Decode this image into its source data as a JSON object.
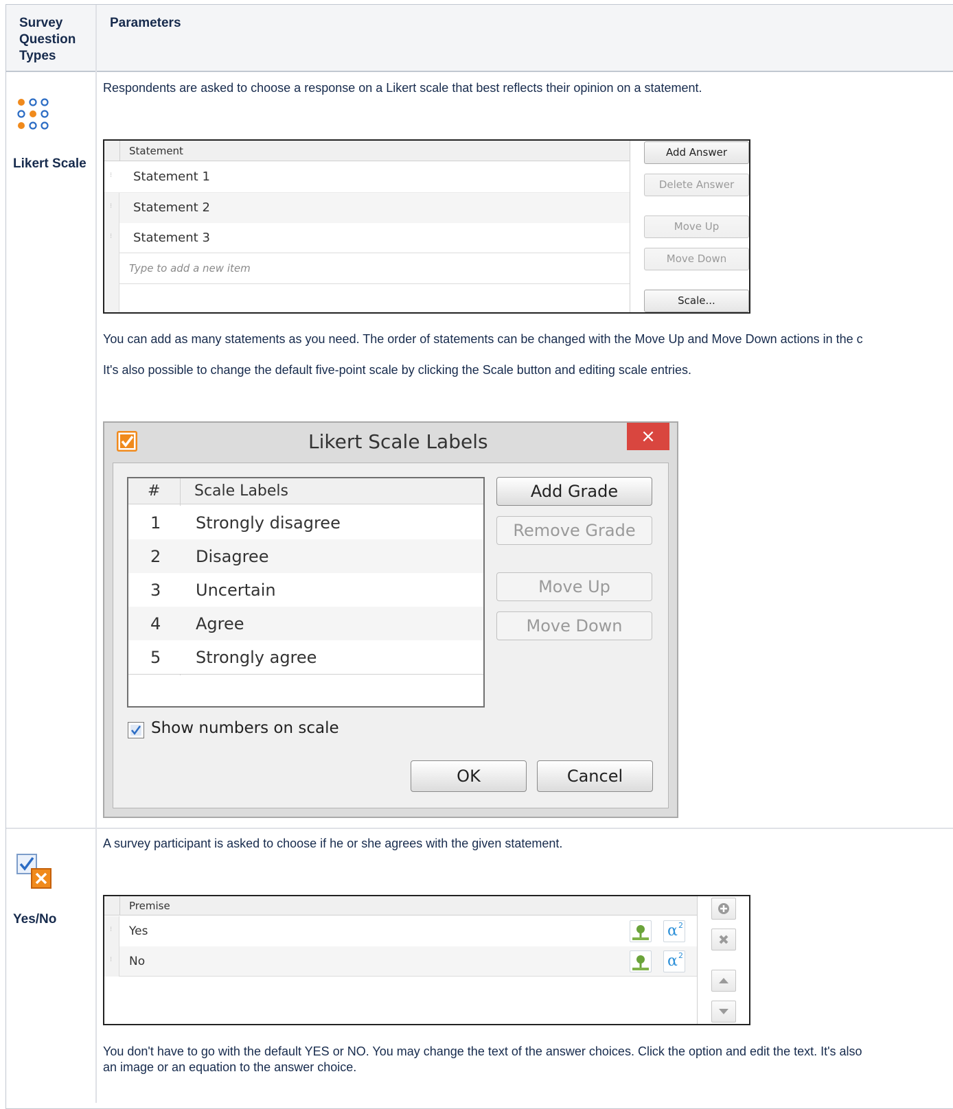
{
  "table": {
    "header_col1": "Survey Question Types",
    "header_col2": "Parameters"
  },
  "likert": {
    "label": "Likert Scale",
    "intro": "Respondents are asked to choose a response on a Likert scale that best reflects  their opinion on a statement.",
    "grid": {
      "header": "Statement",
      "rows": [
        "Statement 1",
        "Statement 2",
        "Statement 3"
      ],
      "placeholder": "Type to add a new item"
    },
    "buttons": {
      "add": "Add Answer",
      "delete": "Delete Answer",
      "move_up": "Move Up",
      "move_down": "Move Down",
      "scale": "Scale..."
    },
    "para1": "You can add as many statements as you need. The order of statements can be changed with the Move Up and Move Down actions in the c",
    "para2": "It's also possible to change the default five-point scale by clicking the Scale button and editing scale entries."
  },
  "dialog": {
    "title": "Likert Scale Labels",
    "close": "×",
    "grid": {
      "col_num": "#",
      "col_label": "Scale Labels",
      "rows": [
        {
          "num": "1",
          "label": "Strongly disagree"
        },
        {
          "num": "2",
          "label": "Disagree"
        },
        {
          "num": "3",
          "label": "Uncertain"
        },
        {
          "num": "4",
          "label": "Agree"
        },
        {
          "num": "5",
          "label": "Strongly agree"
        }
      ]
    },
    "buttons": {
      "add": "Add Grade",
      "remove": "Remove Grade",
      "move_up": "Move Up",
      "move_down": "Move Down",
      "ok": "OK",
      "cancel": "Cancel"
    },
    "checkbox_label": "Show numbers on scale",
    "checkbox_checked": true
  },
  "yesno": {
    "label": "Yes/No",
    "intro": "A survey participant is asked to choose if he or she agrees with the given statement.",
    "grid": {
      "header": "Premise",
      "rows": [
        "Yes",
        "No"
      ],
      "equation_glyph": "α"
    },
    "para_line1": "You don't have to go with the default YES or NO. You may change the text of the answer choices. Click the option and edit the text. It's also",
    "para_line2": "an image or an equation to the answer choice."
  },
  "colors": {
    "accent_orange": "#f08a1c",
    "close_red": "#d9463f",
    "checkbox_blue": "#2b6cc4"
  }
}
